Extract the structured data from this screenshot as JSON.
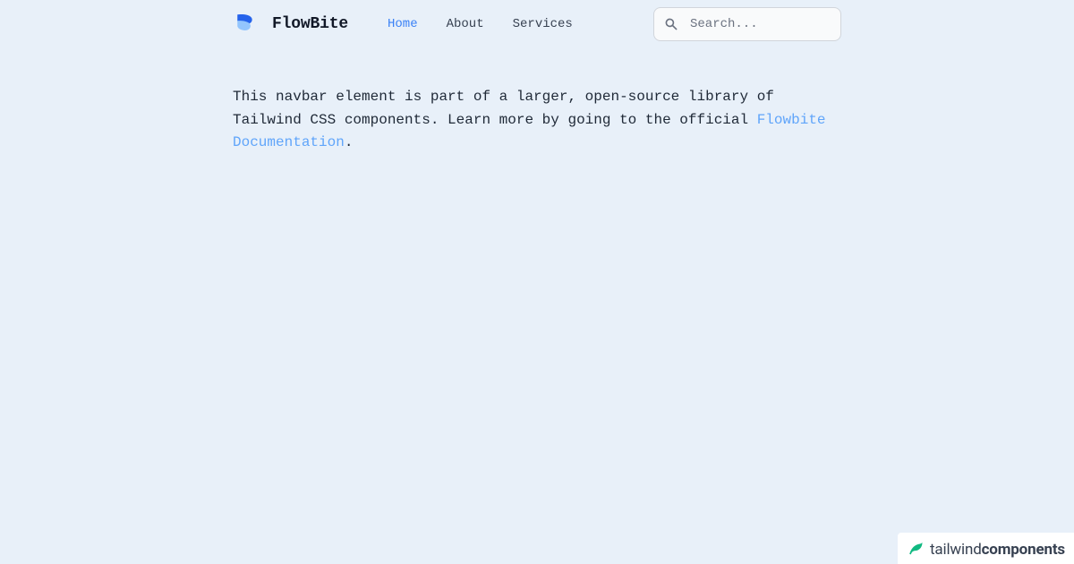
{
  "brand": {
    "name": "FlowBite"
  },
  "nav": {
    "items": [
      {
        "label": "Home",
        "active": true
      },
      {
        "label": "About",
        "active": false
      },
      {
        "label": "Services",
        "active": false
      }
    ]
  },
  "search": {
    "placeholder": "Search..."
  },
  "content": {
    "text_before": "This navbar element is part of a larger, open-source library of Tailwind CSS components. Learn more by going to the official ",
    "link_text": "Flowbite Documentation",
    "text_after": "."
  },
  "footer": {
    "brand_light": "tailwind",
    "brand_bold": "components"
  }
}
